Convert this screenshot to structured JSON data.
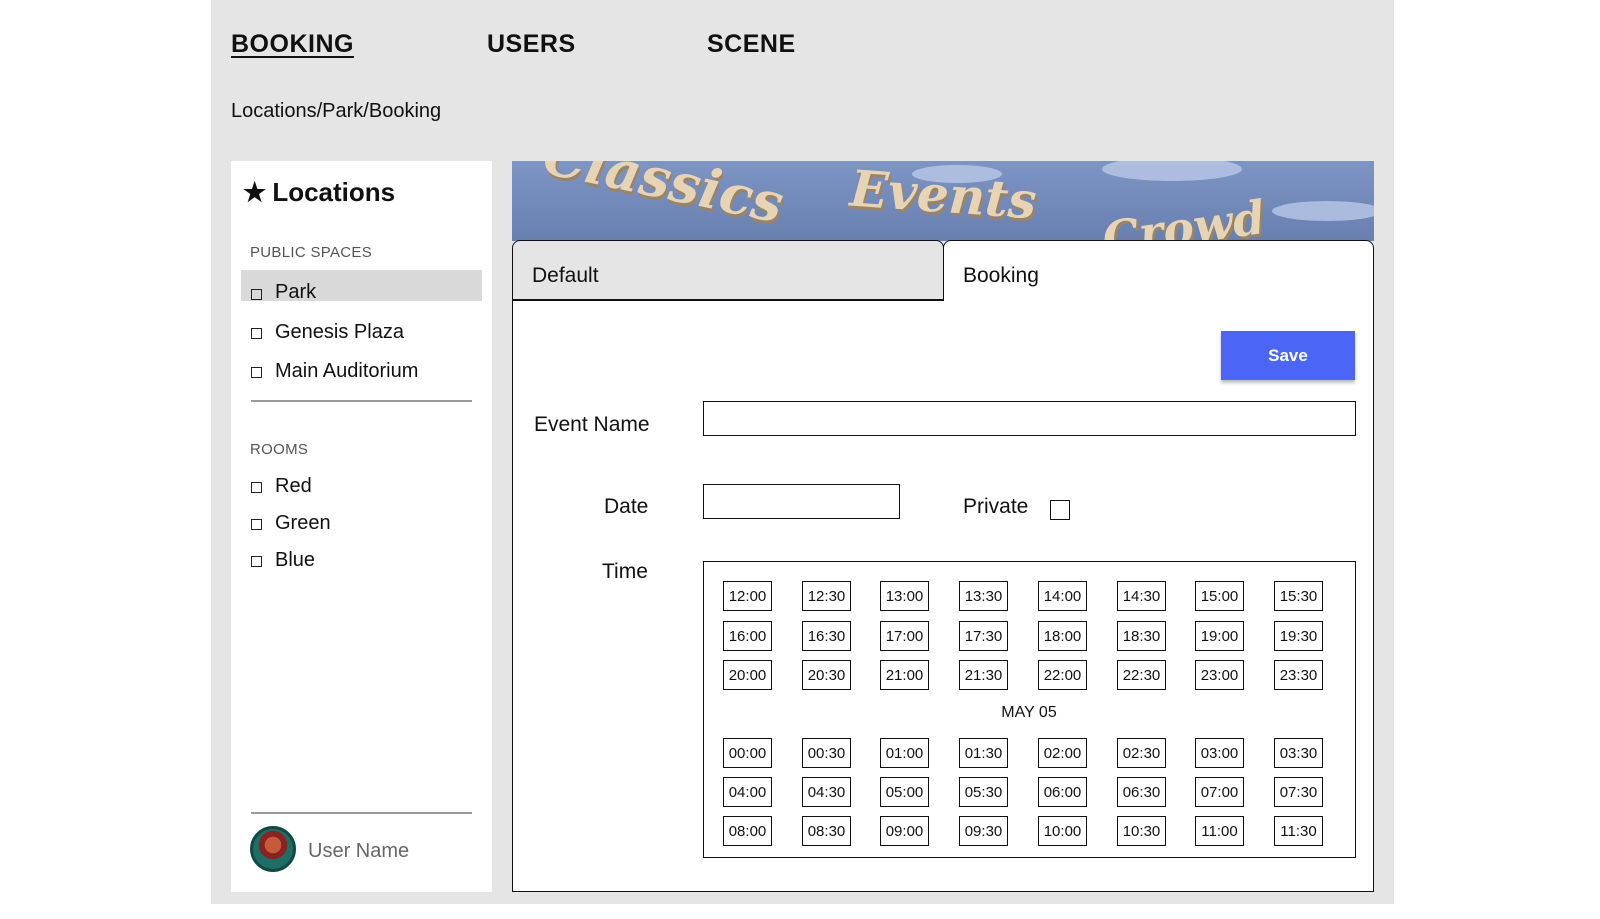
{
  "nav": {
    "items": [
      {
        "label": "BOOKING",
        "active": true
      },
      {
        "label": "USERS",
        "active": false
      },
      {
        "label": "SCENE",
        "active": false
      }
    ]
  },
  "breadcrumb": "Locations/Park/Booking",
  "sidebar": {
    "title_icon": "★",
    "title": "Locations",
    "public_spaces": {
      "heading": "PUBLIC SPACES",
      "items": [
        {
          "label": "Park",
          "selected": true
        },
        {
          "label": "Genesis Plaza",
          "selected": false
        },
        {
          "label": "Main Auditorium",
          "selected": false
        }
      ]
    },
    "rooms": {
      "heading": "ROOMS",
      "items": [
        {
          "label": "Red"
        },
        {
          "label": "Green"
        },
        {
          "label": "Blue"
        }
      ]
    },
    "user": {
      "name": "User Name"
    }
  },
  "banner": {
    "words": [
      "Classics",
      "Events",
      "Crowd"
    ]
  },
  "tabs": [
    {
      "label": "Default",
      "active": false
    },
    {
      "label": "Booking",
      "active": true
    }
  ],
  "form": {
    "save_label": "Save",
    "event_name_label": "Event Name",
    "event_name_value": "",
    "date_label": "Date",
    "date_value": "",
    "private_label": "Private",
    "private_checked": false,
    "time_label": "Time",
    "time_slots_day1": [
      "12:00",
      "12:30",
      "13:00",
      "13:30",
      "14:00",
      "14:30",
      "15:00",
      "15:30",
      "16:00",
      "16:30",
      "17:00",
      "17:30",
      "18:00",
      "18:30",
      "19:00",
      "19:30",
      "20:00",
      "20:30",
      "21:00",
      "21:30",
      "22:00",
      "22:30",
      "23:00",
      "23:30"
    ],
    "day_separator": "MAY 05",
    "time_slots_day2": [
      "00:00",
      "00:30",
      "01:00",
      "01:30",
      "02:00",
      "02:30",
      "03:00",
      "03:30",
      "04:00",
      "04:30",
      "05:00",
      "05:30",
      "06:00",
      "06:30",
      "07:00",
      "07:30",
      "08:00",
      "08:30",
      "09:00",
      "09:30",
      "10:00",
      "10:30",
      "11:00",
      "11:30"
    ]
  },
  "colors": {
    "app_background": "#e5e5e5",
    "save_button": "#4b66f6",
    "selected_item": "#d9d9d9"
  }
}
